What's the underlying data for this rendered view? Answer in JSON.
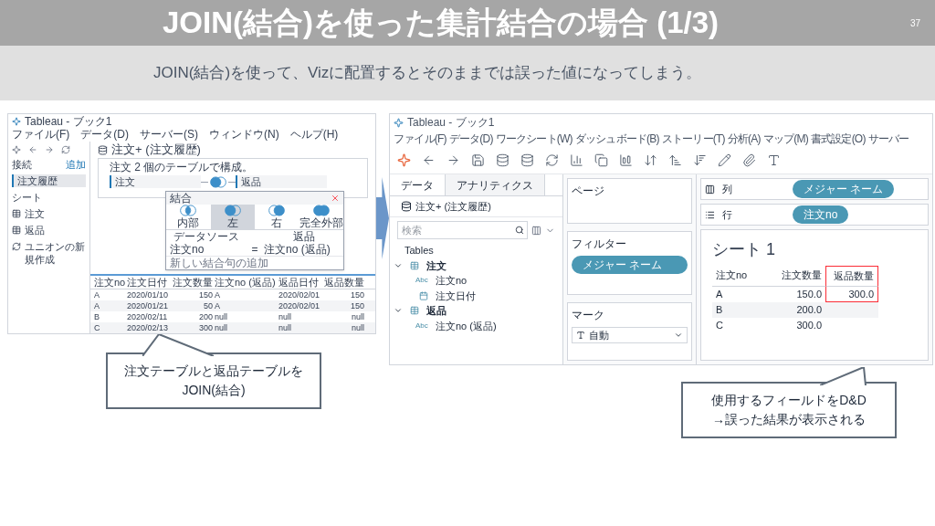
{
  "slide": {
    "title": "JOIN(結合)を使った集計結合の場合 (1/3)",
    "page_number": "37",
    "subtitle": "JOIN(結合)を使って、Vizに配置するとそのままでは誤った値になってしまう。"
  },
  "left_screenshot": {
    "window_title": "Tableau - ブック1",
    "menu": [
      "ファイル(F)",
      "データ(D)",
      "サーバー(S)",
      "ウィンドウ(N)",
      "ヘルプ(H)"
    ],
    "sidebar": {
      "connections_label": "接続",
      "add_link": "追加",
      "connection": "注文履歴",
      "sheets_label": "シート",
      "sheets": [
        "注文",
        "返品"
      ],
      "new_union": "ユニオンの新規作成"
    },
    "datasource_title": "注文+ (注文履歴)",
    "canvas": {
      "caption": "注文 2 個のテーブルで構成。",
      "tables": [
        "注文",
        "返品"
      ]
    },
    "join_dialog": {
      "title": "結合",
      "join_types": [
        {
          "kind": "inner",
          "label": "内部",
          "selected": false
        },
        {
          "kind": "left",
          "label": "左",
          "selected": true
        },
        {
          "kind": "right",
          "label": "右",
          "selected": false
        },
        {
          "kind": "full",
          "label": "完全外部",
          "selected": false
        }
      ],
      "columns": [
        "データソース",
        "返品"
      ],
      "clause": [
        "注文no",
        "=",
        "注文no (返品)"
      ],
      "add_hint": "新しい結合句の追加"
    },
    "grid": {
      "columns": [
        {
          "label": "注文no",
          "numeric": false
        },
        {
          "label": "注文日付",
          "numeric": false
        },
        {
          "label": "注文数量",
          "numeric": true
        },
        {
          "label": "注文no (返品)",
          "numeric": false
        },
        {
          "label": "返品日付",
          "numeric": false
        },
        {
          "label": "返品数量",
          "numeric": true
        }
      ],
      "rows": [
        [
          "A",
          "2020/01/10",
          "150",
          "A",
          "2020/02/01",
          "150"
        ],
        [
          "A",
          "2020/01/21",
          "50",
          "A",
          "2020/02/01",
          "150"
        ],
        [
          "B",
          "2020/02/11",
          "200",
          "null",
          "null",
          "null"
        ],
        [
          "C",
          "2020/02/13",
          "300",
          "null",
          "null",
          "null"
        ]
      ]
    }
  },
  "right_screenshot": {
    "window_title": "Tableau - ブック1",
    "menu": [
      "ファイル(F)",
      "データ(D)",
      "ワークシート(W)",
      "ダッシュボード(B)",
      "ストーリー(T)",
      "分析(A)",
      "マップ(M)",
      "書式設定(O)",
      "サーバー"
    ],
    "data_tabs": [
      {
        "label": "データ",
        "selected": true
      },
      {
        "label": "アナリティクス",
        "selected": false
      }
    ],
    "datasource": "注文+ (注文履歴)",
    "search": {
      "placeholder": "検索"
    },
    "tables_label": "Tables",
    "tree": [
      {
        "kind": "table",
        "name": "注文",
        "expanded": true,
        "children": [
          {
            "kind": "string",
            "type_label": "Abc",
            "name": "注文no"
          },
          {
            "kind": "date",
            "name": "注文日付"
          }
        ]
      },
      {
        "kind": "table",
        "name": "返品",
        "expanded": true,
        "children": [
          {
            "kind": "string",
            "type_label": "Abc",
            "name": "注文no (返品)"
          }
        ]
      }
    ],
    "pages_label": "ページ",
    "filters_label": "フィルター",
    "filter_pills": [
      "メジャー ネーム"
    ],
    "marks_label": "マーク",
    "mark_type": "自動",
    "shelves": [
      {
        "kind": "columns",
        "label": "列",
        "pills": [
          "メジャー ネーム"
        ]
      },
      {
        "kind": "rows",
        "label": "行",
        "pills": [
          "注文no"
        ]
      }
    ],
    "sheet": {
      "title": "シート 1",
      "columns": [
        {
          "label": "注文no",
          "highlighted": false,
          "numeric": false
        },
        {
          "label": "注文数量",
          "highlighted": false,
          "numeric": true
        },
        {
          "label": "返品数量",
          "highlighted": true,
          "numeric": true
        }
      ],
      "rows": [
        {
          "shaded": false,
          "cells": [
            "A",
            "150.0",
            "300.0"
          ]
        },
        {
          "shaded": true,
          "cells": [
            "B",
            "200.0"
          ]
        },
        {
          "shaded": false,
          "cells": [
            "C",
            "300.0"
          ]
        }
      ]
    }
  },
  "callouts": [
    {
      "lines": [
        "注文テーブルと返品テーブルを",
        "JOIN(結合)"
      ]
    },
    {
      "lines": [
        "使用するフィールドをD&D",
        "→誤った結果が表示される"
      ]
    }
  ]
}
